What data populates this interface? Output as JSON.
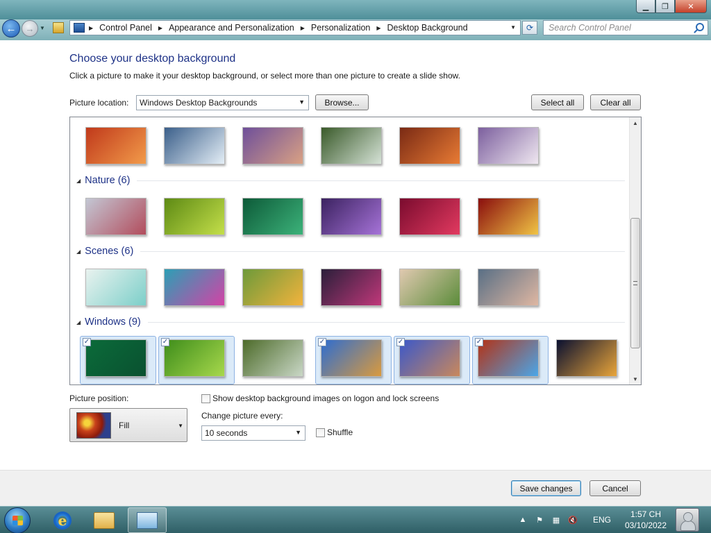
{
  "address": {
    "breadcrumbs": [
      "Control Panel",
      "Appearance and Personalization",
      "Personalization",
      "Desktop Background"
    ],
    "search_placeholder": "Search Control Panel"
  },
  "header": {
    "title": "Choose your desktop background",
    "description": "Click a picture to make it your desktop background, or select more than one picture to create a slide show."
  },
  "location": {
    "label": "Picture location:",
    "value": "Windows Desktop Backgrounds",
    "browse_label": "Browse...",
    "select_all_label": "Select all",
    "clear_all_label": "Clear all"
  },
  "groups": [
    {
      "title": "",
      "items": [
        {
          "name": "red-canyon",
          "selected": false,
          "colors": [
            "#c0391b",
            "#f29b4a"
          ]
        },
        {
          "name": "ice-lake",
          "selected": false,
          "colors": [
            "#3b5f8a",
            "#e4eef6"
          ]
        },
        {
          "name": "rocky-coast-sunset",
          "selected": false,
          "colors": [
            "#6e4f9a",
            "#d9a184"
          ]
        },
        {
          "name": "waterfall",
          "selected": false,
          "colors": [
            "#3a5a2a",
            "#d5e2d6"
          ]
        },
        {
          "name": "stone-arch",
          "selected": false,
          "colors": [
            "#7a2a14",
            "#e87b34"
          ]
        },
        {
          "name": "lavender-field",
          "selected": false,
          "colors": [
            "#7c5f9e",
            "#efe7f0"
          ]
        }
      ]
    },
    {
      "title": "Nature (6)",
      "items": [
        {
          "name": "frost-petals",
          "selected": false,
          "colors": [
            "#c3c7d4",
            "#b24c5c"
          ]
        },
        {
          "name": "succulent",
          "selected": false,
          "colors": [
            "#5d8a14",
            "#c4df4a"
          ]
        },
        {
          "name": "green-leaves",
          "selected": false,
          "colors": [
            "#0d5a38",
            "#3cb27a"
          ]
        },
        {
          "name": "purple-thistle",
          "selected": false,
          "colors": [
            "#3b2260",
            "#a673d8"
          ]
        },
        {
          "name": "red-dahlia",
          "selected": false,
          "colors": [
            "#7a0b2e",
            "#e23a60"
          ]
        },
        {
          "name": "yellow-leaves",
          "selected": false,
          "colors": [
            "#8a0d0d",
            "#f0c445"
          ]
        }
      ]
    },
    {
      "title": "Scenes (6)",
      "items": [
        {
          "name": "floral-sketch",
          "selected": false,
          "colors": [
            "#e9f2ef",
            "#7ccfc9"
          ]
        },
        {
          "name": "colorful-city",
          "selected": false,
          "colors": [
            "#2c9fb5",
            "#d343a6"
          ]
        },
        {
          "name": "bubble-garden",
          "selected": false,
          "colors": [
            "#6d9a3a",
            "#f2b33d"
          ]
        },
        {
          "name": "night-blossoms",
          "selected": false,
          "colors": [
            "#2a1f3a",
            "#c0387a"
          ]
        },
        {
          "name": "spring-path",
          "selected": false,
          "colors": [
            "#e0c9b0",
            "#5b8c3a"
          ]
        },
        {
          "name": "paper-mosaic",
          "selected": false,
          "colors": [
            "#596f85",
            "#dfb7a2"
          ]
        }
      ]
    },
    {
      "title": "Windows (9)",
      "items": [
        {
          "name": "windows-green",
          "selected": true,
          "colors": [
            "#0b6b3a",
            "#0a5130"
          ]
        },
        {
          "name": "fern",
          "selected": true,
          "colors": [
            "#3e8d1b",
            "#a7d84c"
          ]
        },
        {
          "name": "waterfall-cliff",
          "selected": false,
          "colors": [
            "#4d6b2a",
            "#c9d7c6"
          ]
        },
        {
          "name": "sand-dune",
          "selected": true,
          "colors": [
            "#2e6dd0",
            "#d99a3e"
          ]
        },
        {
          "name": "mountain-lake",
          "selected": true,
          "colors": [
            "#3b58c9",
            "#c9885c"
          ]
        },
        {
          "name": "space-needle",
          "selected": true,
          "colors": [
            "#b33216",
            "#4ba6e8"
          ]
        },
        {
          "name": "light-arcs",
          "selected": false,
          "colors": [
            "#0a1030",
            "#e9a53a"
          ]
        }
      ]
    }
  ],
  "position": {
    "label": "Picture position:",
    "value": "Fill"
  },
  "lock_screen_label": "Show desktop background images on logon and lock screens",
  "slideshow": {
    "change_label": "Change picture every:",
    "interval": "10 seconds",
    "shuffle_label": "Shuffle"
  },
  "footer": {
    "save_label": "Save changes",
    "cancel_label": "Cancel"
  },
  "taskbar": {
    "language": "ENG",
    "time": "1:57 CH",
    "date": "03/10/2022"
  }
}
